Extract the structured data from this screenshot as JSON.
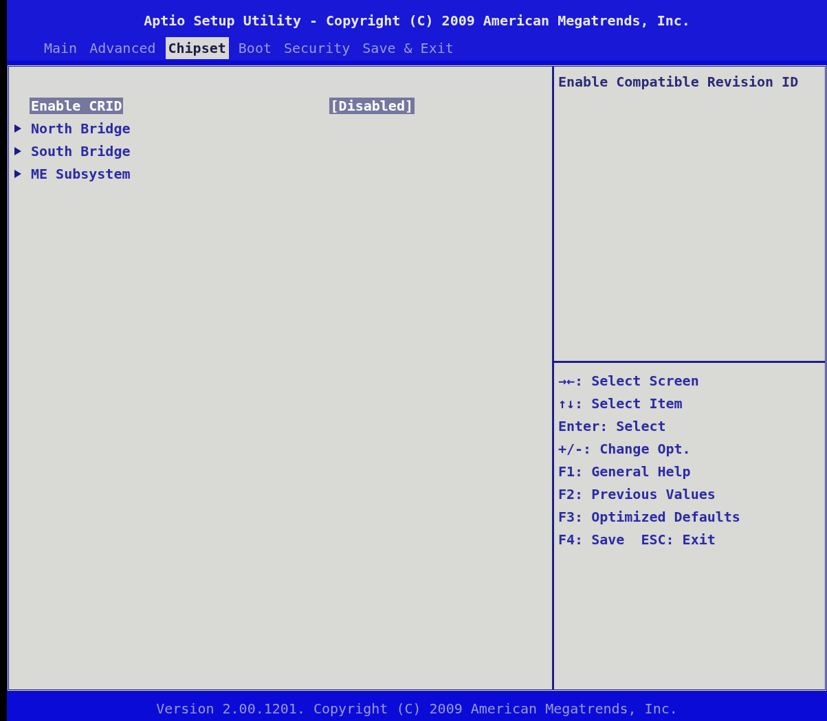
{
  "title": "Aptio Setup Utility - Copyright (C) 2009 American Megatrends, Inc.",
  "tabs": [
    {
      "label": "Main",
      "selected": false
    },
    {
      "label": "Advanced",
      "selected": false
    },
    {
      "label": "Chipset",
      "selected": true
    },
    {
      "label": "Boot",
      "selected": false
    },
    {
      "label": "Security",
      "selected": false
    },
    {
      "label": "Save & Exit",
      "selected": false
    }
  ],
  "items": [
    {
      "kind": "setting",
      "label": "Enable CRID",
      "value": "[Disabled]",
      "selected": true
    },
    {
      "kind": "submenu",
      "label": "North Bridge",
      "selected": false
    },
    {
      "kind": "submenu",
      "label": "South Bridge",
      "selected": false
    },
    {
      "kind": "submenu",
      "label": "ME Subsystem",
      "selected": false
    }
  ],
  "help_text": "Enable Compatible Revision ID",
  "key_help": [
    "→←: Select Screen",
    "↑↓: Select Item",
    "Enter: Select",
    "+/-: Change Opt.",
    "F1: General Help",
    "F2: Previous Values",
    "F3: Optimized Defaults",
    "F4: Save  ESC: Exit"
  ],
  "footer": "Version 2.00.1201. Copyright (C) 2009 American Megatrends, Inc."
}
